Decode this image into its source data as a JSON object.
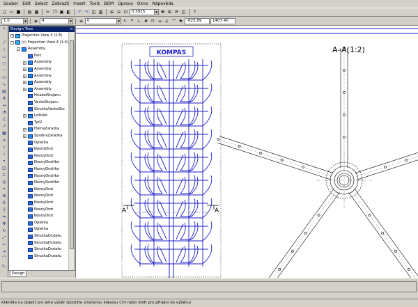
{
  "menu": [
    "Soubor",
    "Edit",
    "Select",
    "Zobrazit",
    "Insert",
    "Tools",
    "BOM",
    "Úprava",
    "Okno",
    "Nápověda"
  ],
  "toolbar": {
    "zoom_value": "0.5925",
    "line_width": "1.0",
    "layer": "4",
    "style_value": "0",
    "coord_x": "-625.89",
    "coord_y": "1407.40"
  },
  "tree": {
    "title": "Design Tree",
    "items": [
      {
        "label": "Projection View 3 (1:5)",
        "level": 0,
        "expander": "+",
        "icon": "view"
      },
      {
        "label": "(c) Projection View 4 (1:5)",
        "level": 0,
        "expander": "-",
        "icon": "view"
      },
      {
        "label": "Assembly",
        "level": 1,
        "expander": "-",
        "icon": "asm"
      },
      {
        "label": "Part",
        "level": 2,
        "expander": "",
        "icon": "part"
      },
      {
        "label": "Assembly",
        "level": 2,
        "expander": "+",
        "icon": "asm"
      },
      {
        "label": "Assembly",
        "level": 2,
        "expander": "+",
        "icon": "asm"
      },
      {
        "label": "Assembly",
        "level": 2,
        "expander": "+",
        "icon": "asm"
      },
      {
        "label": "Assembly",
        "level": 2,
        "expander": "+",
        "icon": "asm"
      },
      {
        "label": "Assembly",
        "level": 2,
        "expander": "+",
        "icon": "asm"
      },
      {
        "label": "HnadelStojanu",
        "level": 2,
        "expander": "",
        "icon": "part"
      },
      {
        "label": "VeckoStojanu",
        "level": 2,
        "expander": "",
        "icon": "part"
      },
      {
        "label": "SkrutkaVeckaSto",
        "level": 2,
        "expander": "",
        "icon": "part"
      },
      {
        "label": "Ložisko",
        "level": 2,
        "expander": "+",
        "icon": "asm"
      },
      {
        "label": "Tyč2",
        "level": 2,
        "expander": "",
        "icon": "part"
      },
      {
        "label": "HomaZarazka",
        "level": 2,
        "expander": "+",
        "icon": "asm"
      },
      {
        "label": "SpodnaZarazka",
        "level": 2,
        "expander": "+",
        "icon": "asm"
      },
      {
        "label": "Opierka",
        "level": 2,
        "expander": "",
        "icon": "part"
      },
      {
        "label": "NosnyDrot",
        "level": 2,
        "expander": "",
        "icon": "part"
      },
      {
        "label": "NosnyDrot",
        "level": 2,
        "expander": "",
        "icon": "part"
      },
      {
        "label": "NosnyDrotHor",
        "level": 2,
        "expander": "",
        "icon": "part"
      },
      {
        "label": "NosnyDrotHor",
        "level": 2,
        "expander": "",
        "icon": "part"
      },
      {
        "label": "NosnyDrotHor",
        "level": 2,
        "expander": "",
        "icon": "part"
      },
      {
        "label": "NosnyDrotHor",
        "level": 2,
        "expander": "",
        "icon": "part"
      },
      {
        "label": "NosnyDrot",
        "level": 2,
        "expander": "",
        "icon": "part"
      },
      {
        "label": "NosnyDrot",
        "level": 2,
        "expander": "",
        "icon": "part"
      },
      {
        "label": "NosnyDrot",
        "level": 2,
        "expander": "",
        "icon": "part"
      },
      {
        "label": "NosnyDrot",
        "level": 2,
        "expander": "",
        "icon": "part"
      },
      {
        "label": "NosnyDrot",
        "level": 2,
        "expander": "",
        "icon": "part"
      },
      {
        "label": "Opierka",
        "level": 2,
        "expander": "",
        "icon": "part"
      },
      {
        "label": "Opierka",
        "level": 2,
        "expander": "",
        "icon": "part"
      },
      {
        "label": "SkrutkaDrziaku",
        "level": 2,
        "expander": "",
        "icon": "part"
      },
      {
        "label": "SkrutkaDrziaku",
        "level": 2,
        "expander": "",
        "icon": "part"
      },
      {
        "label": "SkrutkaDrziaku",
        "level": 2,
        "expander": "",
        "icon": "part"
      },
      {
        "label": "SkrutkaDrziaku",
        "level": 2,
        "expander": "",
        "icon": "part"
      }
    ],
    "tab_label": "Design"
  },
  "drawing": {
    "logo": "KOMPAS",
    "section_title": "A–A(1:2)",
    "section_letter_left": "A",
    "section_letter_right": "A",
    "colors": {
      "rack": "#1c1cc8",
      "section": "#000000",
      "frame": "#1c1cc8"
    }
  },
  "status": "Klikněte na objekt pro jeho výběr (podržte stlačenou klávesu Ctrl nebo Shift pro přidání do výběru)"
}
